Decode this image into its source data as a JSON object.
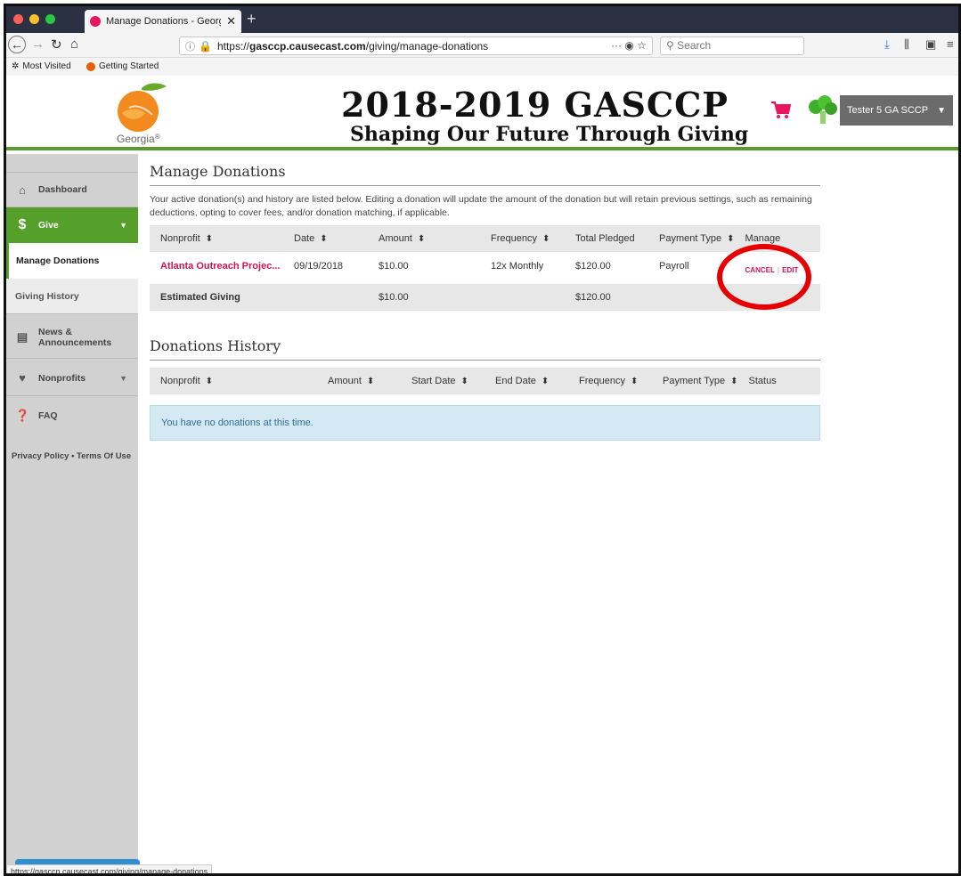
{
  "browser": {
    "tab_title": "Manage Donations - Georgia St",
    "url_scheme": "https://",
    "url_host": "gasccp.causecast.com",
    "url_path": "/giving/manage-donations",
    "search_placeholder": "Search",
    "url_extras": "···",
    "bookmarks": [
      "Most Visited",
      "Getting Started"
    ],
    "status_url": "https://gasccp.causecast.com/giving/manage-donations"
  },
  "header": {
    "logo_text": "Georgia",
    "logo_reg": "®",
    "title": "2018-2019 GASCCP",
    "subtitle": "Shaping Our Future Through Giving",
    "user_name": "Tester 5 GA SCCP"
  },
  "sidebar": {
    "dashboard": "Dashboard",
    "give": "Give",
    "manage_donations": "Manage Donations",
    "giving_history": "Giving History",
    "news_line1": "News &",
    "news_line2": "Announcements",
    "nonprofits": "Nonprofits",
    "faq": "FAQ",
    "privacy": "Privacy Policy",
    "dot": "•",
    "terms": "Terms Of Use"
  },
  "manage": {
    "title": "Manage Donations",
    "description": "Your active donation(s) and history are listed below. Editing a donation will update the amount of the donation but will retain previous settings, such as remaining deductions, opting to cover fees, and/or donation matching, if applicable.",
    "columns": [
      "Nonprofit",
      "Date",
      "Amount",
      "Frequency",
      "Total Pledged",
      "Payment Type",
      "Manage"
    ],
    "row": {
      "nonprofit": "Atlanta Outreach Projec...",
      "date": "09/19/2018",
      "amount": "$10.00",
      "frequency": "12x Monthly",
      "total": "$120.00",
      "payment": "Payroll",
      "cancel": "CANCEL",
      "edit": "EDIT"
    },
    "estimated": {
      "label": "Estimated Giving",
      "amount": "$10.00",
      "total": "$120.00"
    }
  },
  "history": {
    "title": "Donations History",
    "columns": [
      "Nonprofit",
      "Amount",
      "Start Date",
      "End Date",
      "Frequency",
      "Payment Type",
      "Status"
    ],
    "empty": "You have no donations at this time."
  },
  "colors": {
    "brand_green": "#55a02b",
    "accent_pink": "#d0145a",
    "highlight_red": "#e60000"
  }
}
